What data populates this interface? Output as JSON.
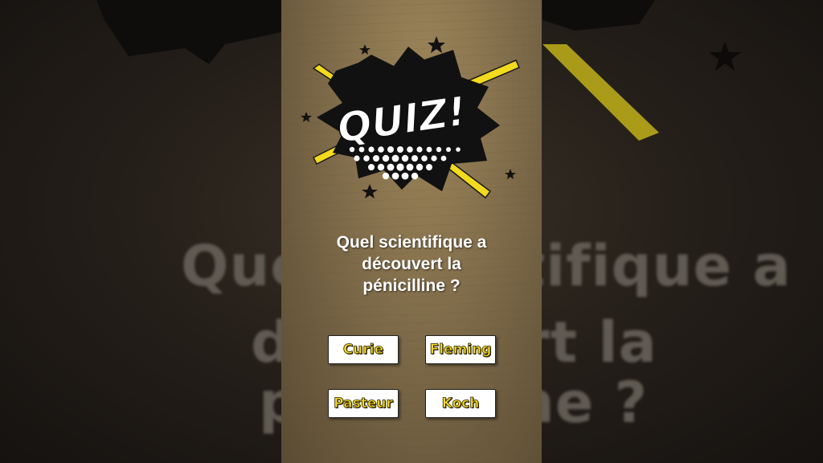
{
  "quiz": {
    "badge_text": "QUIZ!",
    "question_lines": [
      "Quel scientifique a",
      "découvert la",
      "pénicilline ?"
    ],
    "answers": [
      "Curie",
      "Fleming",
      "Pasteur",
      "Koch"
    ]
  },
  "colors": {
    "accent_yellow": "#f3da1c",
    "burst_black": "#111111",
    "panel_paper": "#8a7550"
  }
}
